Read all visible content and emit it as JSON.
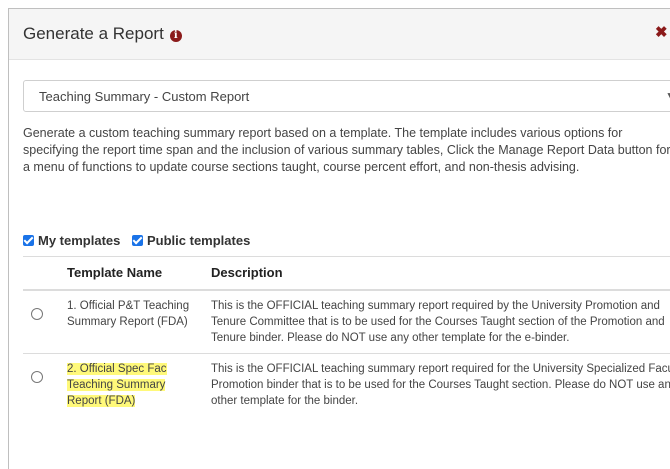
{
  "modal": {
    "title": "Generate a Report",
    "info_icon": "info-circle-icon",
    "close_icon": "close-icon",
    "accent_color": "#8b1a1a"
  },
  "report_select": {
    "selected": "Teaching Summary - Custom Report"
  },
  "description": "Generate a custom teaching summary report based on a template. The template includes various options for specifying the report time span and the inclusion of various summary tables, Click the Manage Report Data button for a menu of functions to update course sections taught, course percent effort, and non-thesis advising.",
  "filters": {
    "my_templates": {
      "label": "My templates",
      "checked": true
    },
    "public_templates": {
      "label": "Public templates",
      "checked": true
    }
  },
  "table": {
    "headers": [
      "Template Name",
      "Description"
    ],
    "rows": [
      {
        "name": "1. Official P&T Teaching Summary Report (FDA)",
        "description": "This is the OFFICIAL teaching summary report required by the University Promotion and Tenure Committee that is to be used for the Courses Taught section of the Promotion and Tenure binder. Please do NOT use any other template for the e-binder.",
        "selected": false
      },
      {
        "name": "2. Official Spec Fac Teaching Summary Report (FDA)",
        "description": "This is the OFFICIAL teaching summary report required for the University Specialized Faculty Promotion binder that is to be used for the Courses Taught section. Please do NOT use any other template for the binder.",
        "selected": false,
        "highlighted": true
      }
    ]
  }
}
